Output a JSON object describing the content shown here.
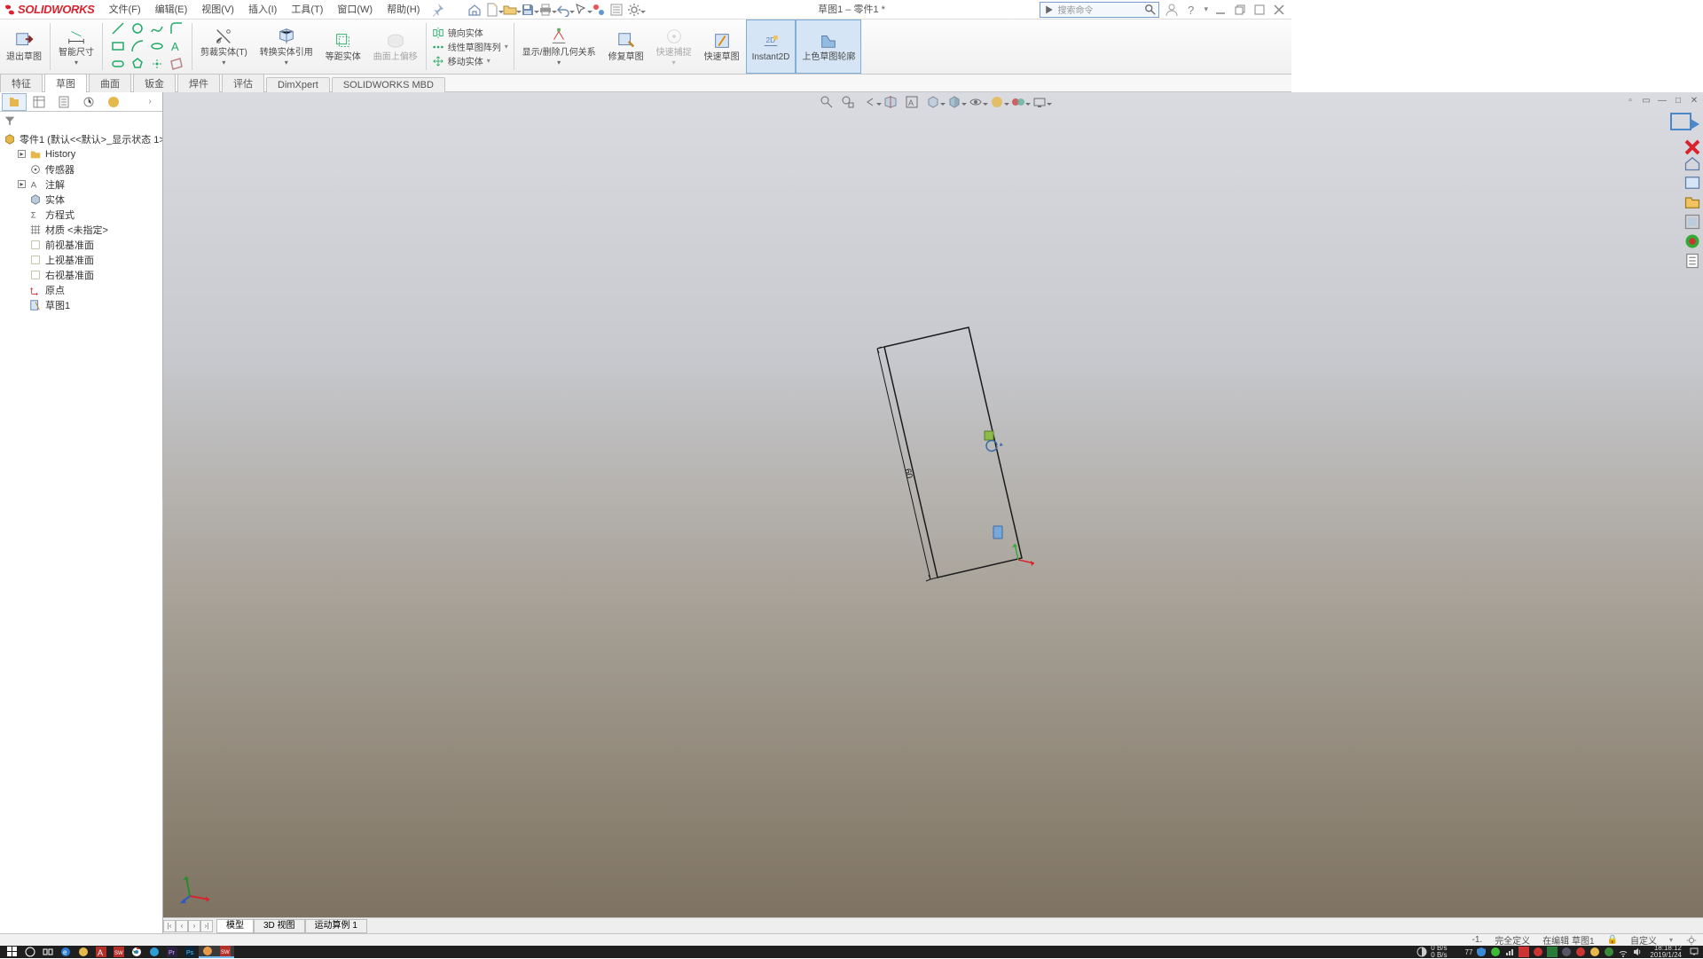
{
  "brand": "SOLIDWORKS",
  "doc_title": "草图1 – 零件1 *",
  "menu": {
    "file": "文件(F)",
    "edit": "编辑(E)",
    "view": "视图(V)",
    "insert": "插入(I)",
    "tools": "工具(T)",
    "window": "窗口(W)",
    "help": "帮助(H)"
  },
  "search": {
    "placeholder": "搜索命令"
  },
  "ribbon": {
    "exit_sketch": "退出草图",
    "smart_dim": "智能尺寸",
    "trim": "剪裁实体(T)",
    "convert": "转换实体引用",
    "offset": "等距实体",
    "surface_offset": "曲面上偏移",
    "mirror": "镜向实体",
    "linear_pattern": "线性草图阵列",
    "move": "移动实体",
    "disp_del_rel": "显示/删除几何关系",
    "repair": "修复草图",
    "quick_snap": "快速捕捉",
    "rapid_sketch": "快速草图",
    "instant2d": "Instant2D",
    "shaded_contour": "上色草图轮廓"
  },
  "cmdtabs": {
    "features": "特征",
    "sketch": "草图",
    "surfaces": "曲面",
    "sheetmetal": "钣金",
    "weldments": "焊件",
    "evaluate": "评估",
    "dimxpert": "DimXpert",
    "mbd": "SOLIDWORKS MBD"
  },
  "tree": {
    "root": "零件1  (默认<<默认>_显示状态 1>)",
    "history": "History",
    "sensors": "传感器",
    "annotations": "注解",
    "solidbodies": "实体",
    "equations": "方程式",
    "material": "材质 <未指定>",
    "front": "前视基准面",
    "top": "上视基准面",
    "right": "右视基准面",
    "origin": "原点",
    "sketch1": "草图1"
  },
  "gtabs": {
    "model": "模型",
    "view3d": "3D 视图",
    "motion": "运动算例 1"
  },
  "status": {
    "coord": "-1.",
    "fullydef": "完全定义",
    "editing": "在编辑 草图1",
    "custom": "自定义"
  },
  "sketch": {
    "dim": "60"
  },
  "taskbar": {
    "time": "18:18:12",
    "date": "2019/1/24",
    "net_up": "0 B/s",
    "net_dn": "0 B/s"
  }
}
